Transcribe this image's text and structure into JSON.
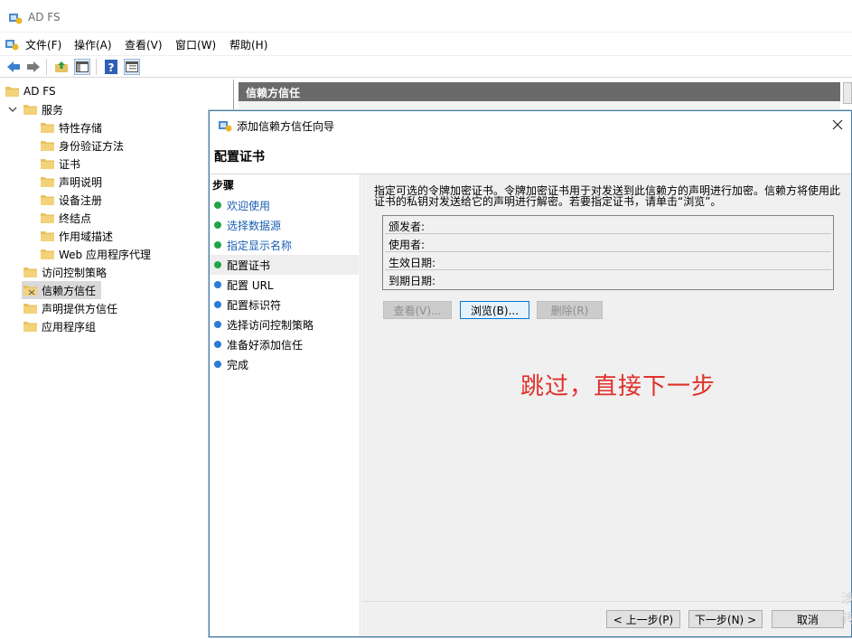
{
  "window": {
    "title": "AD FS"
  },
  "menu": [
    "文件(F)",
    "操作(A)",
    "查看(V)",
    "窗口(W)",
    "帮助(H)"
  ],
  "toolbar": {
    "icons": [
      "back-arrow-icon",
      "forward-arrow-icon",
      "up-folder-icon",
      "show-hide-tree-icon",
      "help-icon",
      "show-hide-action-pane-icon"
    ]
  },
  "tree": {
    "root": "AD FS",
    "service": "服务",
    "service_children": [
      "特性存储",
      "身份验证方法",
      "证书",
      "声明说明",
      "设备注册",
      "终结点",
      "作用域描述",
      "Web 应用程序代理"
    ],
    "top_items": [
      "访问控制策略",
      "信赖方信任",
      "声明提供方信任",
      "应用程序组"
    ],
    "selected": "信赖方信任"
  },
  "right_pane": {
    "header": "信赖方信任"
  },
  "wizard": {
    "title": "添加信赖方信任向导",
    "heading": "配置证书",
    "steps_title": "步骤",
    "steps": [
      {
        "label": "欢迎使用",
        "state": "done"
      },
      {
        "label": "选择数据源",
        "state": "done"
      },
      {
        "label": "指定显示名称",
        "state": "done"
      },
      {
        "label": "配置证书",
        "state": "current"
      },
      {
        "label": "配置 URL",
        "state": "todo"
      },
      {
        "label": "配置标识符",
        "state": "todo"
      },
      {
        "label": "选择访问控制策略",
        "state": "todo"
      },
      {
        "label": "准备好添加信任",
        "state": "todo"
      },
      {
        "label": "完成",
        "state": "todo"
      }
    ],
    "description": "指定可选的令牌加密证书。令牌加密证书用于对发送到此信赖方的声明进行加密。信赖方将使用此证书的私钥对发送给它的声明进行解密。若要指定证书，请单击“浏览”。",
    "cert_fields": [
      "颁发者:",
      "使用者:",
      "生效日期:",
      "到期日期:"
    ],
    "buttons": {
      "view": "查看(V)...",
      "browse": "浏览(B)...",
      "remove": "删除(R)"
    },
    "annotation": "跳过，直接下一步",
    "nav": {
      "back": "< 上一步(P)",
      "next": "下一步(N) >",
      "cancel": "取消"
    }
  },
  "colors": {
    "step_done_dot": "#22a447",
    "step_todo_dot": "#2b7bd6",
    "annotation": "#e0302b",
    "header_bar": "#6a6a6a"
  },
  "watermark": "涉\n转"
}
